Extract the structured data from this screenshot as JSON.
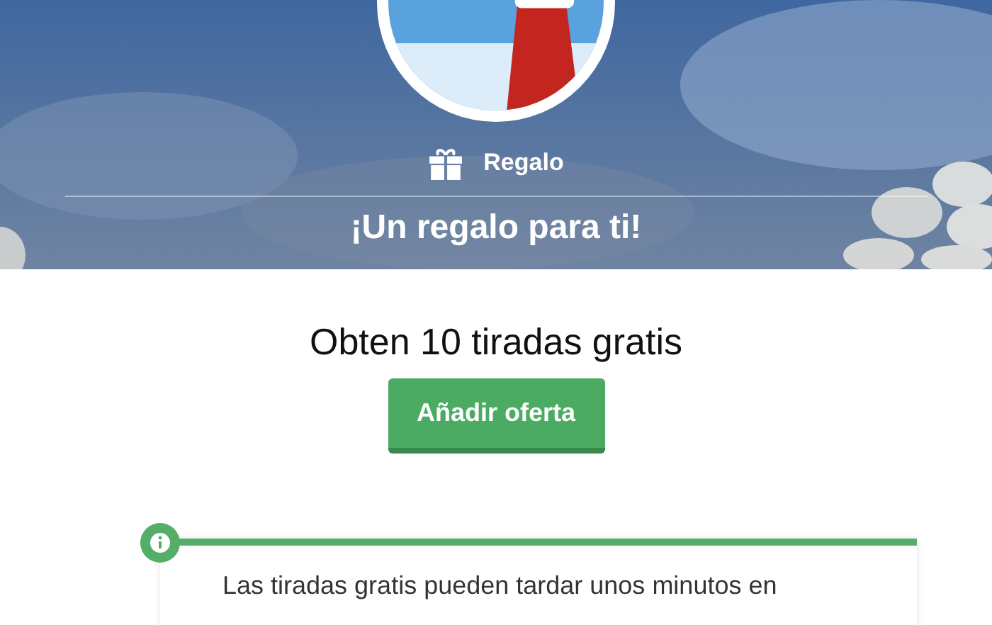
{
  "header": {
    "category": "Regalo",
    "title": "¡Un regalo para ti!"
  },
  "offer": {
    "headline": "Obten 10 tiradas gratis",
    "button": "Añadir oferta"
  },
  "notice": {
    "text": "Las tiradas gratis pueden tardar unos minutos en"
  }
}
